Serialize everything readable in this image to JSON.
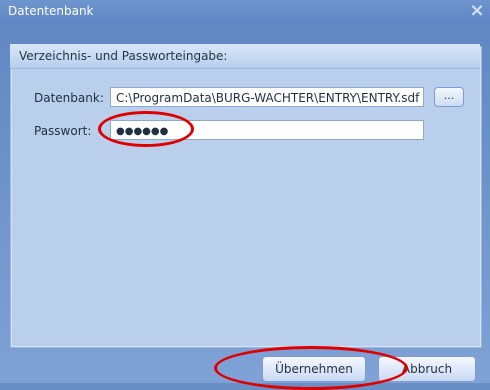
{
  "window": {
    "title": "Datentenbank",
    "close_icon": "×"
  },
  "group": {
    "title": "Verzeichnis- und Passworteingabe:"
  },
  "form": {
    "database_label": "Datenbank:",
    "database_value": "C:\\ProgramData\\BURG-WACHTER\\ENTRY\\ENTRY.sdf",
    "browse_label": "...",
    "password_label": "Passwort:",
    "password_value": "●●●●●●"
  },
  "buttons": {
    "apply": "Übernehmen",
    "cancel": "Abbruch"
  },
  "colors": {
    "annotation": "#e00000"
  }
}
